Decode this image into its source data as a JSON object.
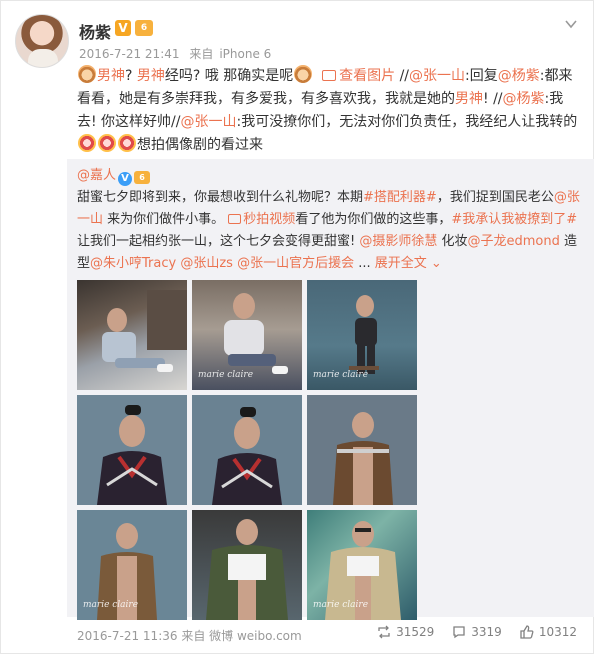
{
  "author": {
    "name": "杨紫",
    "verified_badge": "V",
    "level_badge": "6"
  },
  "meta": {
    "timestamp": "2016-7-21 21:41",
    "source_prefix": "来自",
    "source": "iPhone 6"
  },
  "post": {
    "t1": "男神",
    "t2": "? ",
    "t3": "男神",
    "t4": "经吗? 哦 那确实是呢",
    "view_image": "查看图片",
    "t5": " //",
    "mention1": "@张一山",
    "t6": ":回复",
    "mention2": "@杨紫",
    "t7": ":都来看看，她是有多崇拜我，有多爱我，有多喜欢我，我就是她的",
    "t8": "男神",
    "t9": "! //",
    "mention3": "@杨紫",
    "t10": ":我去! 你这样好帅//",
    "mention4": "@张一山",
    "t11": ":我可没撩你们，无法对你们负责任，我经纪人让我转的",
    "t12": "想拍偶像剧的看过来"
  },
  "repost": {
    "author": "@嘉人",
    "verified_badge": "V",
    "level_badge": "6",
    "r1": "甜蜜七夕即将到来，你最想收到什么礼物呢？本期",
    "tag1": "#搭配利器#",
    "r2": "，我们捉到国民老公",
    "mention1": "@张一山",
    "r3": " 来为你们做件小事。",
    "video_link": "秒拍视频",
    "r4": "看了他为你们做的这些事，",
    "tag2": "#我承认我被撩到了#",
    "r5": "让我们一起相约张一山，这个七夕会变得更甜蜜! ",
    "mention2": "@摄影师徐慧",
    "r6": " 化妆",
    "mention3": "@子龙edmond",
    "r7": " 造型",
    "mention4": "@朱小哼Tracy",
    "r8": " ",
    "mention5": "@张山zs",
    "r9": " ",
    "mention6": "@张一山官方后援会",
    "r10": " ... ",
    "expand": "展开全文",
    "images": [
      {
        "alt": "photo-1",
        "watermark": ""
      },
      {
        "alt": "photo-2",
        "watermark": "marie claire"
      },
      {
        "alt": "photo-3",
        "watermark": "marie claire"
      },
      {
        "alt": "photo-4",
        "watermark": ""
      },
      {
        "alt": "photo-5",
        "watermark": ""
      },
      {
        "alt": "photo-6",
        "watermark": ""
      },
      {
        "alt": "photo-7",
        "watermark": "marie claire"
      },
      {
        "alt": "photo-8",
        "watermark": ""
      },
      {
        "alt": "photo-9",
        "watermark": "marie claire"
      }
    ],
    "footer": {
      "timestamp": "2016-7-21 11:36",
      "source_prefix": "来自",
      "source": "微博 weibo.com",
      "reposts": "31529",
      "comments": "3319",
      "likes": "10312"
    }
  },
  "colors": {
    "link": "#eb7350",
    "repost_bg": "#f2f2f5",
    "muted": "#999999"
  }
}
